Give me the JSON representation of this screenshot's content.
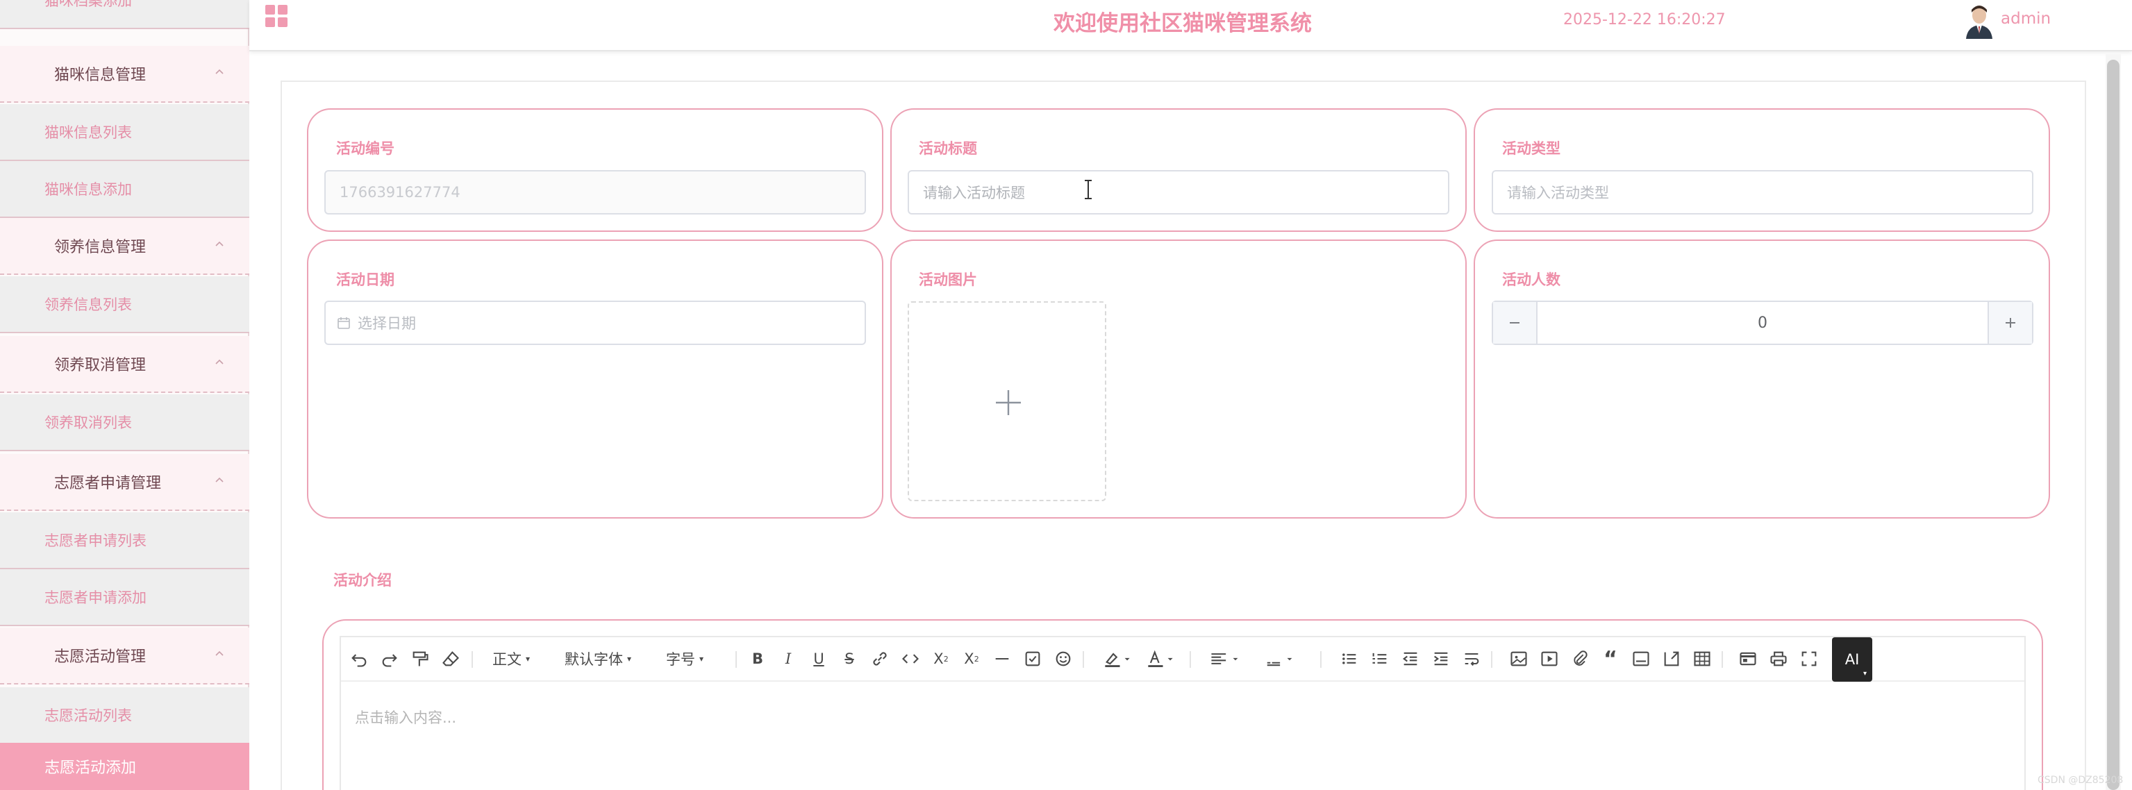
{
  "sidebar": {
    "items": [
      {
        "label": "猫咪档案添加",
        "kind": "sub"
      },
      {
        "label": "猫咪信息管理",
        "kind": "group"
      },
      {
        "label": "猫咪信息列表",
        "kind": "sub"
      },
      {
        "label": "猫咪信息添加",
        "kind": "sub"
      },
      {
        "label": "领养信息管理",
        "kind": "group"
      },
      {
        "label": "领养信息列表",
        "kind": "sub"
      },
      {
        "label": "领养取消管理",
        "kind": "group"
      },
      {
        "label": "领养取消列表",
        "kind": "sub"
      },
      {
        "label": "志愿者申请管理",
        "kind": "group"
      },
      {
        "label": "志愿者申请列表",
        "kind": "sub"
      },
      {
        "label": "志愿者申请添加",
        "kind": "sub"
      },
      {
        "label": "志愿活动管理",
        "kind": "group"
      },
      {
        "label": "志愿活动列表",
        "kind": "sub"
      },
      {
        "label": "志愿活动添加",
        "kind": "active"
      }
    ]
  },
  "header": {
    "title": "欢迎使用社区猫咪管理系统",
    "datetime": "2025-12-22 16:20:27",
    "username": "admin"
  },
  "form": {
    "activity_no": {
      "label": "活动编号",
      "value": "1766391627774"
    },
    "activity_title": {
      "label": "活动标题",
      "placeholder": "请输入活动标题"
    },
    "activity_type": {
      "label": "活动类型",
      "placeholder": "请输入活动类型"
    },
    "activity_date": {
      "label": "活动日期",
      "placeholder": "选择日期"
    },
    "activity_image": {
      "label": "活动图片"
    },
    "activity_count": {
      "label": "活动人数",
      "value": "0"
    },
    "activity_intro": {
      "label": "活动介绍",
      "placeholder": "点击输入内容..."
    }
  },
  "toolbar": {
    "paragraph": "正文",
    "font": "默认字体",
    "size": "字号",
    "ai": "AI"
  },
  "watermark": "CSDN @DZ85208",
  "colors": {
    "accent": "#f08fa8",
    "active_bg": "#f5a2b7",
    "border_pink": "#eca2b5"
  }
}
